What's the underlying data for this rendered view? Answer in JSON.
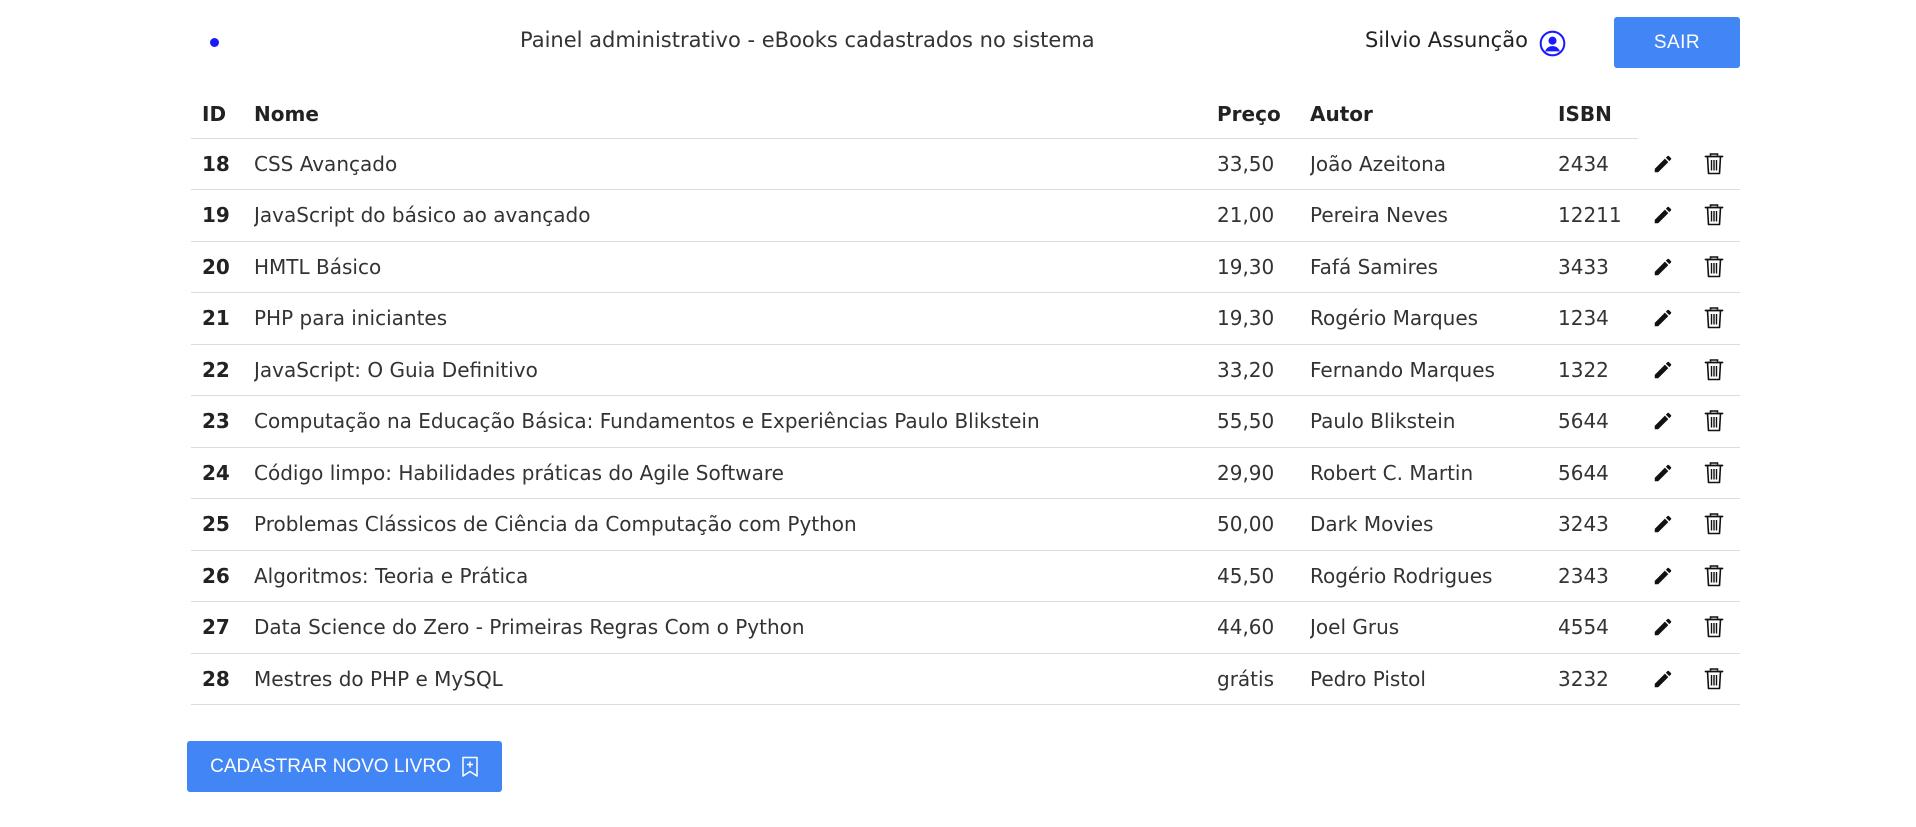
{
  "header": {
    "title": "Painel administrativo - eBooks cadastrados no sistema",
    "user_name": "Silvio Assunção",
    "logout_label": "SAIR"
  },
  "table": {
    "columns": [
      "ID",
      "Nome",
      "Preço",
      "Autor",
      "ISBN"
    ],
    "rows": [
      {
        "id": "18",
        "nome": "CSS Avançado",
        "preco": "33,50",
        "autor": "João Azeitona",
        "isbn": "2434"
      },
      {
        "id": "19",
        "nome": "JavaScript do básico ao avançado",
        "preco": "21,00",
        "autor": "Pereira Neves",
        "isbn": "12211"
      },
      {
        "id": "20",
        "nome": "HMTL Básico",
        "preco": "19,30",
        "autor": "Fafá Samires",
        "isbn": "3433"
      },
      {
        "id": "21",
        "nome": "PHP para iniciantes",
        "preco": "19,30",
        "autor": "Rogério Marques",
        "isbn": "1234"
      },
      {
        "id": "22",
        "nome": "JavaScript: O Guia Definitivo",
        "preco": "33,20",
        "autor": "Fernando Marques",
        "isbn": "1322"
      },
      {
        "id": "23",
        "nome": "Computação na Educação Básica: Fundamentos e Experiências Paulo Blikstein",
        "preco": "55,50",
        "autor": "Paulo Blikstein",
        "isbn": "5644"
      },
      {
        "id": "24",
        "nome": "Código limpo: Habilidades práticas do Agile Software",
        "preco": "29,90",
        "autor": "Robert C. Martin",
        "isbn": "5644"
      },
      {
        "id": "25",
        "nome": "Problemas Clássicos de Ciência da Computação com Python",
        "preco": "50,00",
        "autor": "Dark Movies",
        "isbn": "3243"
      },
      {
        "id": "26",
        "nome": "Algoritmos: Teoria e Prática",
        "preco": "45,50",
        "autor": "Rogério Rodrigues",
        "isbn": "2343"
      },
      {
        "id": "27",
        "nome": "Data Science do Zero - Primeiras Regras Com o Python",
        "preco": "44,60",
        "autor": "Joel Grus",
        "isbn": "4554"
      },
      {
        "id": "28",
        "nome": "Mestres do PHP e MySQL",
        "preco": "grátis",
        "autor": "Pedro Pistol",
        "isbn": "3232"
      }
    ],
    "row_icons": [
      "pencil-icon",
      "trash-icon"
    ]
  },
  "actions": {
    "add_book_label": "CADASTRAR NOVO LIVRO",
    "add_book_icon": "bookmark-plus-icon"
  },
  "colors": {
    "accent": "#4285f4",
    "dot": "#1a1aff",
    "user_icon": "#1a1aff"
  }
}
